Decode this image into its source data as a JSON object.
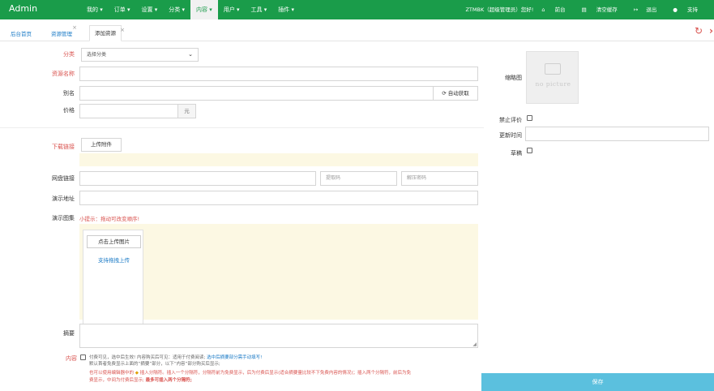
{
  "nav": {
    "brand": "Admin",
    "menu": [
      {
        "label": "我的 ▾"
      },
      {
        "label": "订单 ▾"
      },
      {
        "label": "设置 ▾"
      },
      {
        "label": "分类 ▾"
      },
      {
        "label": "内容 ▾"
      },
      {
        "label": "用户 ▾"
      },
      {
        "label": "工具 ▾"
      },
      {
        "label": "插件 ▾"
      }
    ],
    "greeting": "ZTMBK（超级管理员）您好!",
    "home": "前台",
    "clear_cache": "清空缓存",
    "logout": "退出",
    "user": "支持"
  },
  "tabs": {
    "home": "后台首页",
    "resource_mgmt": "资源管理",
    "add_resource": "添加资源",
    "close_symbol": "×"
  },
  "form": {
    "category_label": "分类",
    "category_value": "选择分类",
    "name_label": "资源名称",
    "alias_label": "别名",
    "auto_fetch": "自动获取",
    "price_label": "价格",
    "price_unit": "元",
    "download_label": "下载链接",
    "upload_attachment": "上传附件",
    "netdisk_label": "网盘链接",
    "extract_code_placeholder": "提取码",
    "unzip_pwd_placeholder": "解压密码",
    "demo_url_label": "演示地址",
    "gallery_label": "演示图集",
    "gallery_hint": "小提示：拖动可改变顺序!",
    "upload_image": "点击上传图片",
    "drag_upload": "支持拖拽上传",
    "summary_label": "摘要",
    "content_label": "内容",
    "paid_note_a": "付费可见，选中后生效! 内容购买后可见：适用于付费阅读; ",
    "paid_note_b": "选中后摘要部分需手动填写!",
    "paid_note_2": "默认首者免费显示上面的“摘要”部分，以下“内容”部分购买后显示;",
    "paid_note_3": "也可以使用编辑器中的 ",
    "paid_note_3b": " 插入分隔符。插入一个分隔符，分隔符前为免费显示，后为付费后显示(适合摘要量比较不下免费内容的情况)；插入两个分隔符，前后为免",
    "paid_note_4": "费显示，中间为付费后显示; ",
    "paid_note_4b": "最多可插入两个分隔符;"
  },
  "side": {
    "thumb_label": "缩略图",
    "no_picture": "no picture",
    "disable_comment_label": "禁止评价",
    "update_time_label": "更新时间",
    "draft_label": "草稿",
    "save_button": "保存"
  },
  "colors": {
    "nav_green": "#1a9c4a",
    "link_blue": "#1a7ac6",
    "required_red": "#d9534f",
    "upload_bg": "#fcf8e3",
    "save_blue": "#5bc0de"
  }
}
